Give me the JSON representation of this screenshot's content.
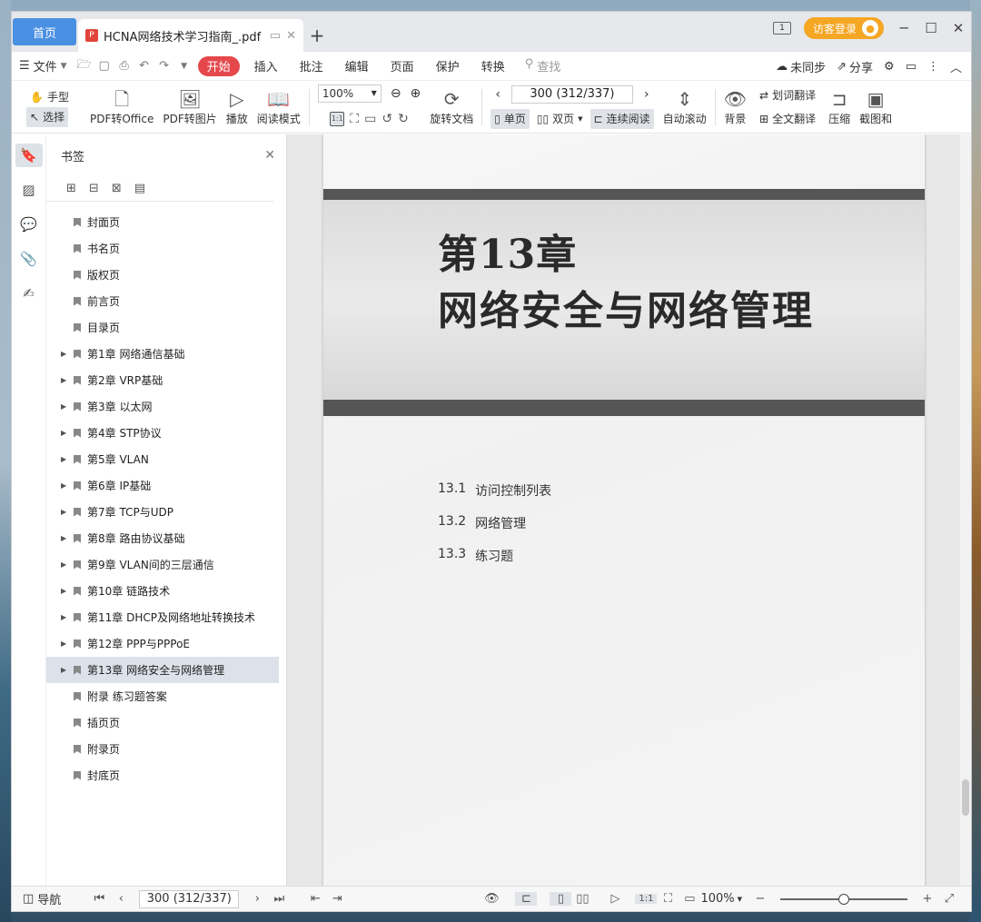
{
  "titlebar": {
    "home_tab": "首页",
    "doc_tab_title": "HCNA网络技术学习指南_.pdf",
    "login_label": "访客登录",
    "page_badge": "1"
  },
  "menubar": {
    "file": "文件",
    "items": [
      "开始",
      "插入",
      "批注",
      "编辑",
      "页面",
      "保护",
      "转换"
    ],
    "search_placeholder": "查找",
    "sync": "未同步",
    "share": "分享"
  },
  "ribbon": {
    "hand": "手型",
    "select": "选择",
    "pdf_to_office": "PDF转Office",
    "pdf_to_image": "PDF转图片",
    "play": "播放",
    "read_mode": "阅读模式",
    "zoom": "100%",
    "one_to_one": "1:1",
    "rotate_doc": "旋转文档",
    "page_indicator": "300 (312/337)",
    "single_page": "单页",
    "double_page": "双页",
    "continuous": "连续阅读",
    "auto_scroll": "自动滚动",
    "background": "背景",
    "word_translate": "划词翻译",
    "full_translate": "全文翻译",
    "compress": "压缩",
    "screenshot": "截图和"
  },
  "bookmark_panel": {
    "title": "书签",
    "items": [
      {
        "label": "封面页",
        "expandable": false
      },
      {
        "label": "书名页",
        "expandable": false
      },
      {
        "label": "版权页",
        "expandable": false
      },
      {
        "label": "前言页",
        "expandable": false
      },
      {
        "label": "目录页",
        "expandable": false
      },
      {
        "label": "第1章  网络通信基础",
        "expandable": true
      },
      {
        "label": "第2章  VRP基础",
        "expandable": true
      },
      {
        "label": "第3章  以太网",
        "expandable": true
      },
      {
        "label": "第4章  STP协议",
        "expandable": true
      },
      {
        "label": "第5章  VLAN",
        "expandable": true
      },
      {
        "label": "第6章  IP基础",
        "expandable": true
      },
      {
        "label": "第7章  TCP与UDP",
        "expandable": true
      },
      {
        "label": "第8章  路由协议基础",
        "expandable": true
      },
      {
        "label": "第9章  VLAN间的三层通信",
        "expandable": true
      },
      {
        "label": "第10章  链路技术",
        "expandable": true
      },
      {
        "label": "第11章  DHCP及网络地址转换技术",
        "expandable": true
      },
      {
        "label": "第12章  PPP与PPPoE",
        "expandable": true
      },
      {
        "label": "第13章  网络安全与网络管理",
        "expandable": true,
        "selected": true
      },
      {
        "label": "附录  练习题答案",
        "expandable": false
      },
      {
        "label": "插页页",
        "expandable": false
      },
      {
        "label": "附录页",
        "expandable": false
      },
      {
        "label": "封底页",
        "expandable": false
      }
    ]
  },
  "document": {
    "chapter_number": "第13章",
    "chapter_title": "网络安全与网络管理",
    "toc": [
      {
        "num": "13.1",
        "title": "访问控制列表"
      },
      {
        "num": "13.2",
        "title": "网络管理"
      },
      {
        "num": "13.3",
        "title": "练习题"
      }
    ]
  },
  "statusbar": {
    "nav": "导航",
    "page_indicator": "300 (312/337)",
    "zoom": "100%",
    "one_to_one": "1:1",
    "zoom_slider_level": 0.5
  },
  "colors": {
    "home_tab": "#4a90e2",
    "start_active": "#e5474b",
    "login": "#f5a623"
  }
}
